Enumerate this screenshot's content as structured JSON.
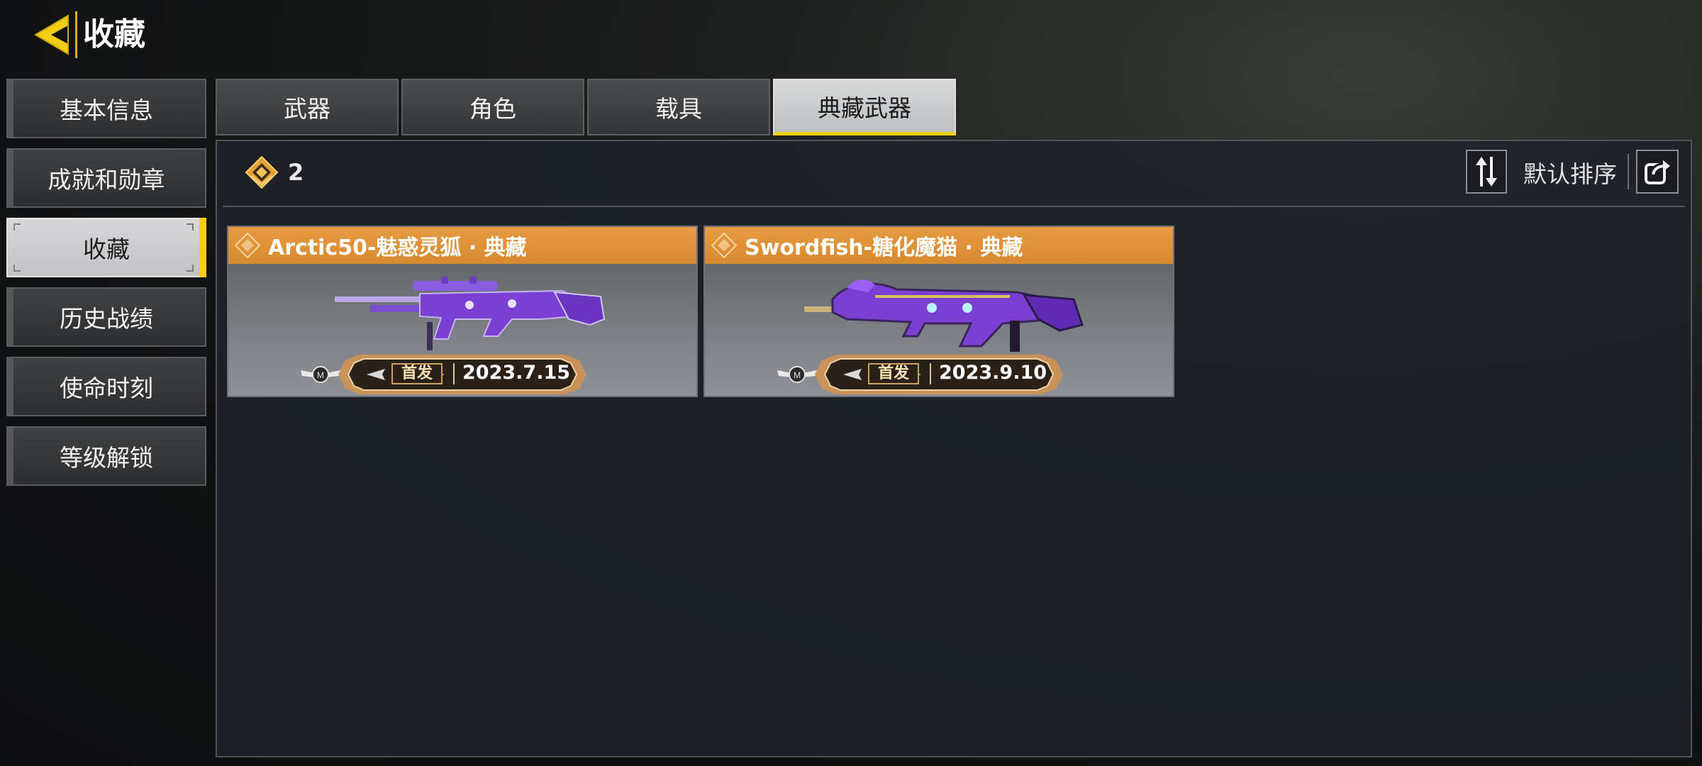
{
  "header": {
    "title": "收藏"
  },
  "sidebar": {
    "items": [
      {
        "label": "基本信息"
      },
      {
        "label": "成就和勋章"
      },
      {
        "label": "收藏"
      },
      {
        "label": "历史战绩"
      },
      {
        "label": "使命时刻"
      },
      {
        "label": "等级解锁"
      }
    ],
    "active_index": 2
  },
  "tabs": {
    "items": [
      {
        "label": "武器"
      },
      {
        "label": "角色"
      },
      {
        "label": "载具"
      },
      {
        "label": "典藏武器"
      }
    ],
    "active_index": 3
  },
  "toolbar": {
    "count": "2",
    "sort_label": "默认排序"
  },
  "cards": [
    {
      "title": "Arctic50-魅惑灵狐 · 典藏",
      "tag": "首发",
      "date": "2023.7.15"
    },
    {
      "title": "Swordfish-糖化魔猫 · 典藏",
      "tag": "首发",
      "date": "2023.9.10"
    }
  ],
  "colors": {
    "accent_yellow": "#f1cd16",
    "card_header_orange": "#e59a41",
    "weapon_purple": "#7b3fd1"
  },
  "icons": {
    "back": "back-arrow-icon",
    "count": "legendary-emblem-icon",
    "sort": "sort-arrows-icon",
    "share": "share-icon",
    "card": "diamond-icon",
    "rank": "winged-rank-icon"
  }
}
